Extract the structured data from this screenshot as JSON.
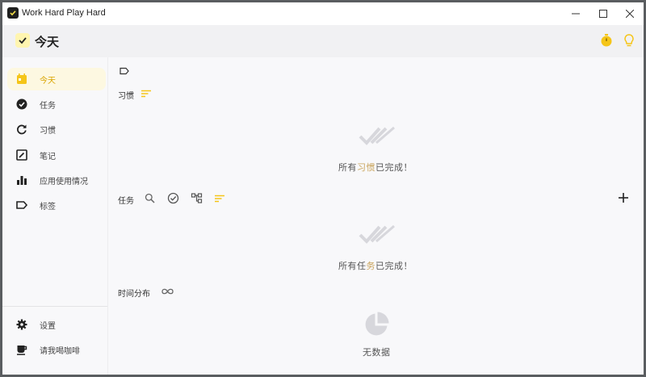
{
  "window": {
    "title": "Work Hard Play Hard",
    "controls": {
      "minimize": "—",
      "maximize": "☐",
      "close": "✕"
    }
  },
  "header": {
    "title": "今天",
    "icons": [
      "stopwatch-icon",
      "lightbulb-icon"
    ]
  },
  "sidebar": {
    "items": [
      {
        "label": "今天",
        "icon": "calendar-icon",
        "active": true
      },
      {
        "label": "任务",
        "icon": "check-circle-icon",
        "active": false
      },
      {
        "label": "习惯",
        "icon": "refresh-icon",
        "active": false
      },
      {
        "label": "笔记",
        "icon": "note-edit-icon",
        "active": false
      },
      {
        "label": "应用使用情况",
        "icon": "bar-chart-icon",
        "active": false
      },
      {
        "label": "标签",
        "icon": "tag-icon",
        "active": false
      }
    ],
    "bottom": [
      {
        "label": "设置",
        "icon": "gear-icon"
      },
      {
        "label": "请我喝咖啡",
        "icon": "coffee-icon"
      }
    ]
  },
  "habits": {
    "title": "习惯",
    "empty": {
      "prefix": "所有",
      "highlight": "习惯",
      "suffix": "已完成！"
    }
  },
  "tasks": {
    "title": "任务",
    "empty": {
      "prefix": "所有任",
      "highlight": "务",
      "suffix": "已完成！"
    }
  },
  "time_distribution": {
    "title": "时间分布",
    "empty": "无数据"
  },
  "colors": {
    "accent": "#f5c518",
    "accent_dark": "#d9a400",
    "active_bg": "#fdf8e1",
    "muted_icon": "#d7d7dc"
  }
}
